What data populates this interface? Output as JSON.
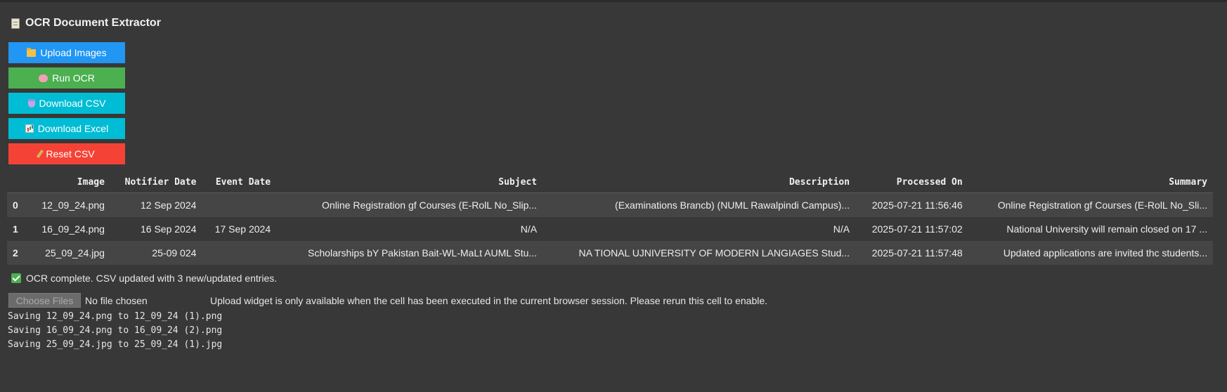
{
  "app": {
    "title": "OCR Document Extractor",
    "icon": "document-icon"
  },
  "buttons": {
    "upload": {
      "label": "Upload Images",
      "icon": "folder-icon",
      "color": "#2196f3"
    },
    "run": {
      "label": "Run OCR",
      "icon": "brain-icon",
      "color": "#4caf50"
    },
    "csv": {
      "label": "Download CSV",
      "icon": "flask-icon",
      "color": "#00bcd4"
    },
    "excel": {
      "label": "Download Excel",
      "icon": "bar-chart-icon",
      "color": "#00bcd4"
    },
    "reset": {
      "label": "Reset CSV",
      "icon": "broom-icon",
      "color": "#f44336"
    }
  },
  "table": {
    "headers": [
      "",
      "Image",
      "Notifier Date",
      "Event Date",
      "Subject",
      "Description",
      "Processed On",
      "Summary"
    ],
    "rows": [
      {
        "index": "0",
        "image": "12_09_24.png",
        "notifier_date": "12 Sep 2024",
        "event_date": "",
        "subject": "Online Registration gf Courses (E-RolL No_Slip...",
        "description": "(Examinations Brancb) (NUML Rawalpindi Campus)...",
        "processed_on": "2025-07-21 11:56:46",
        "summary": "Online Registration gf Courses (E-RolL No_Sli..."
      },
      {
        "index": "1",
        "image": "16_09_24.png",
        "notifier_date": "16 Sep 2024",
        "event_date": "17 Sep 2024",
        "subject": "N/A",
        "description": "N/A",
        "processed_on": "2025-07-21 11:57:02",
        "summary": "National University will remain closed on 17 ..."
      },
      {
        "index": "2",
        "image": "25_09_24.jpg",
        "notifier_date": "25-09 024",
        "event_date": "",
        "subject": "Scholarships bY Pakistan Bait-WL-MaLt AUML Stu...",
        "description": "NA TIONAL UJNIVERSITY OF MODERN LANGIAGES Stud...",
        "processed_on": "2025-07-21 11:57:48",
        "summary": "Updated applications are invited thc students..."
      }
    ]
  },
  "status": {
    "icon": "check-icon",
    "text": "OCR complete. CSV updated with 3 new/updated entries."
  },
  "file_input": {
    "button_label": "Choose Files",
    "no_file_text": "No file chosen",
    "note": "Upload widget is only available when the cell has been executed in the current browser session. Please rerun this cell to enable."
  },
  "log": [
    "Saving 12_09_24.png to 12_09_24 (1).png",
    "Saving 16_09_24.png to 16_09_24 (2).png",
    "Saving 25_09_24.jpg to 25_09_24 (1).jpg"
  ]
}
